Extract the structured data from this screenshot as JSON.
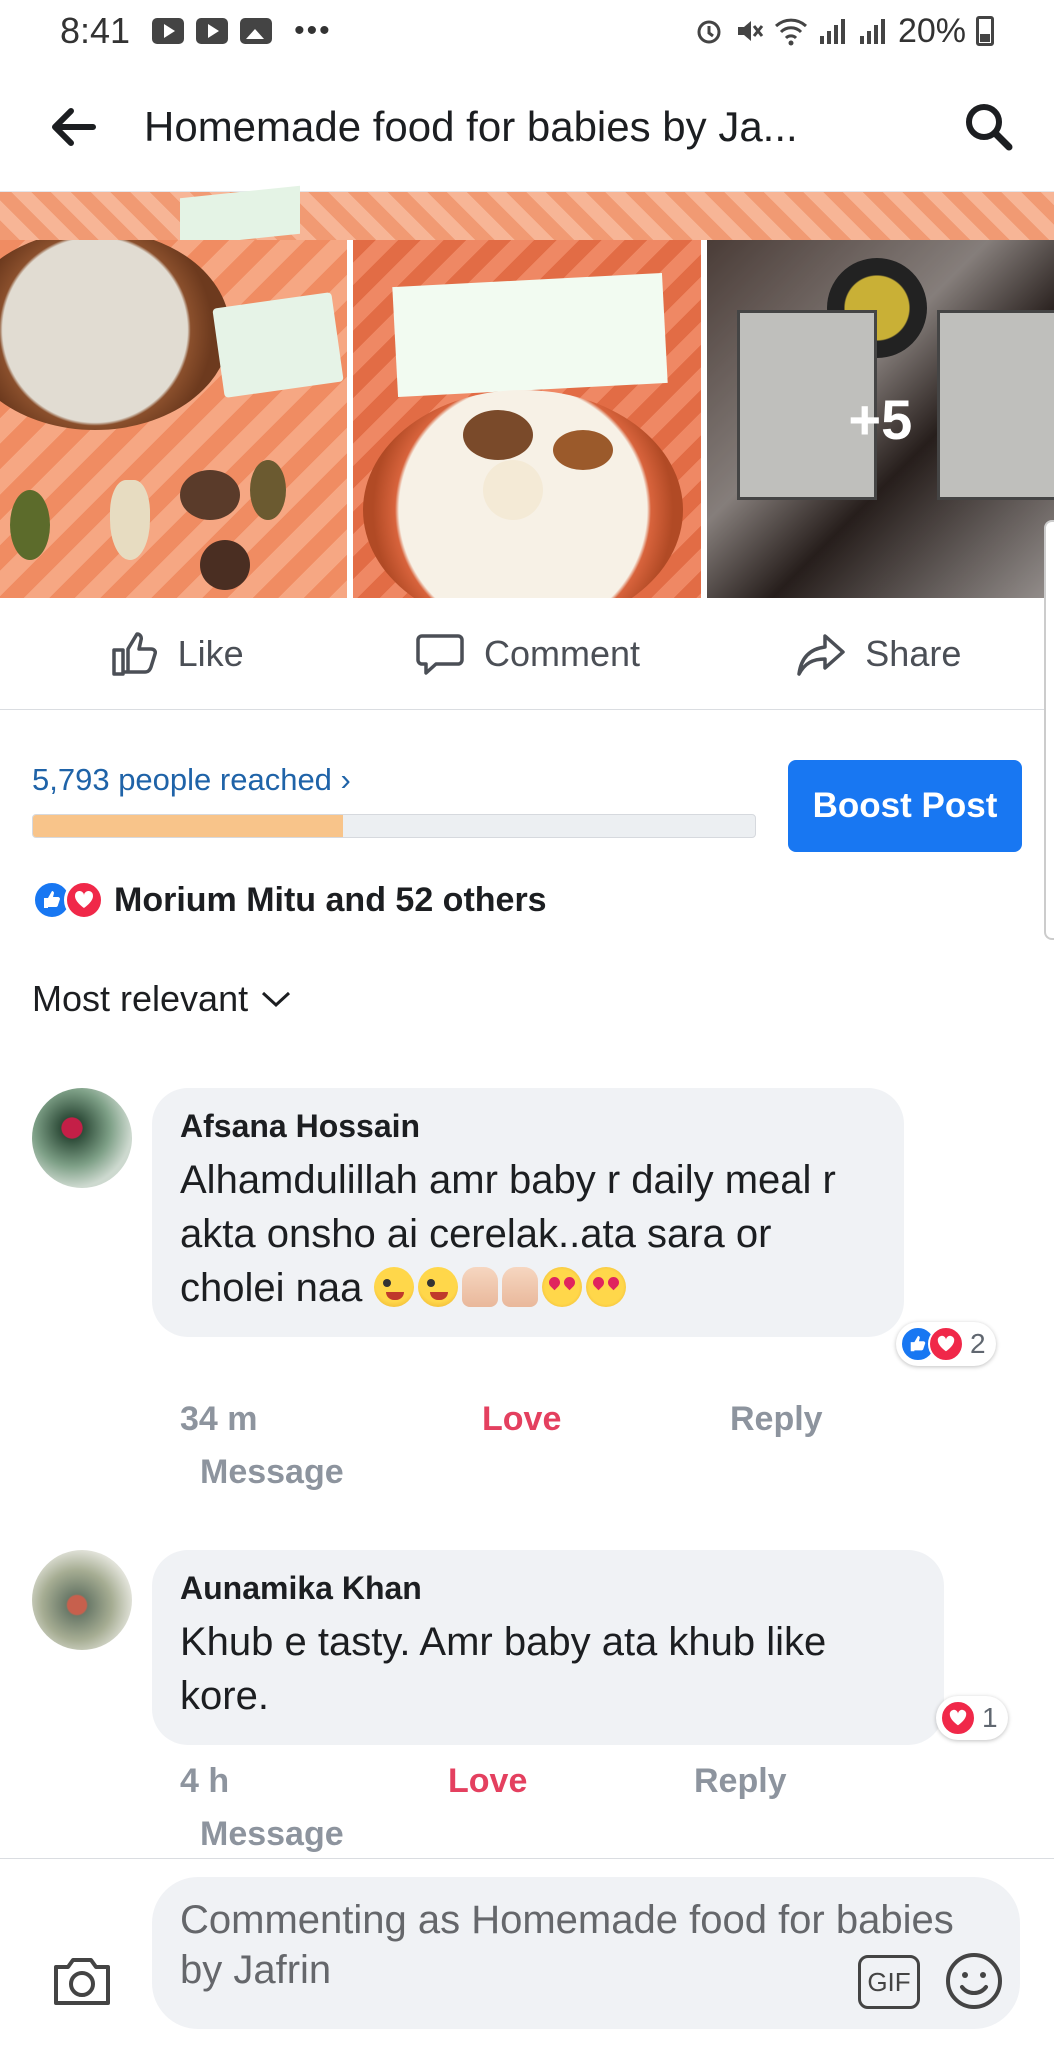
{
  "status_bar": {
    "time": "8:41",
    "battery": "20%",
    "icons": [
      "youtube-icon",
      "youtube-icon",
      "gallery-icon",
      "more-dots-icon",
      "alarm-icon",
      "mute-icon",
      "wifi-icon",
      "signal-icon",
      "signal-icon",
      "battery-icon"
    ]
  },
  "header": {
    "title": "Homemade food for babies by Ja...",
    "back_icon": "back-arrow-icon",
    "search_icon": "search-icon"
  },
  "photos": {
    "more_count": "+5"
  },
  "actions": {
    "like": "Like",
    "comment": "Comment",
    "share": "Share"
  },
  "reach": {
    "text": "5,793 people reached",
    "progress_fraction": 0.43,
    "boost_label": "Boost Post",
    "boost_color": "#1877f2"
  },
  "reactions": {
    "summary": "Morium Mitu and 52 others",
    "types": [
      "like",
      "love"
    ]
  },
  "sort": {
    "label": "Most relevant"
  },
  "comments": [
    {
      "author": "Afsana Hossain",
      "text": "Alhamdulillah amr baby r daily meal r akta onsho ai cerelak..ata sara or cholei naa",
      "emojis": [
        "winking-face",
        "winking-face",
        "thumbs-up",
        "thumbs-up",
        "heart-eyes",
        "heart-eyes"
      ],
      "reaction_count": "2",
      "time": "34 m",
      "love_label": "Love",
      "reply_label": "Reply",
      "message_label": "Message"
    },
    {
      "author": "Aunamika Khan",
      "text": "Khub e tasty. Amr baby ata khub like kore.",
      "reaction_count": "1",
      "time": "4 h",
      "love_label": "Love",
      "reply_label": "Reply",
      "message_label": "Message"
    }
  ],
  "composer": {
    "placeholder": "Commenting as Homemade food for babies by Jafrin",
    "gif_label": "GIF"
  },
  "colors": {
    "accent": "#1877f2",
    "love": "#e4405f",
    "reach_fill": "#f8c48a"
  }
}
